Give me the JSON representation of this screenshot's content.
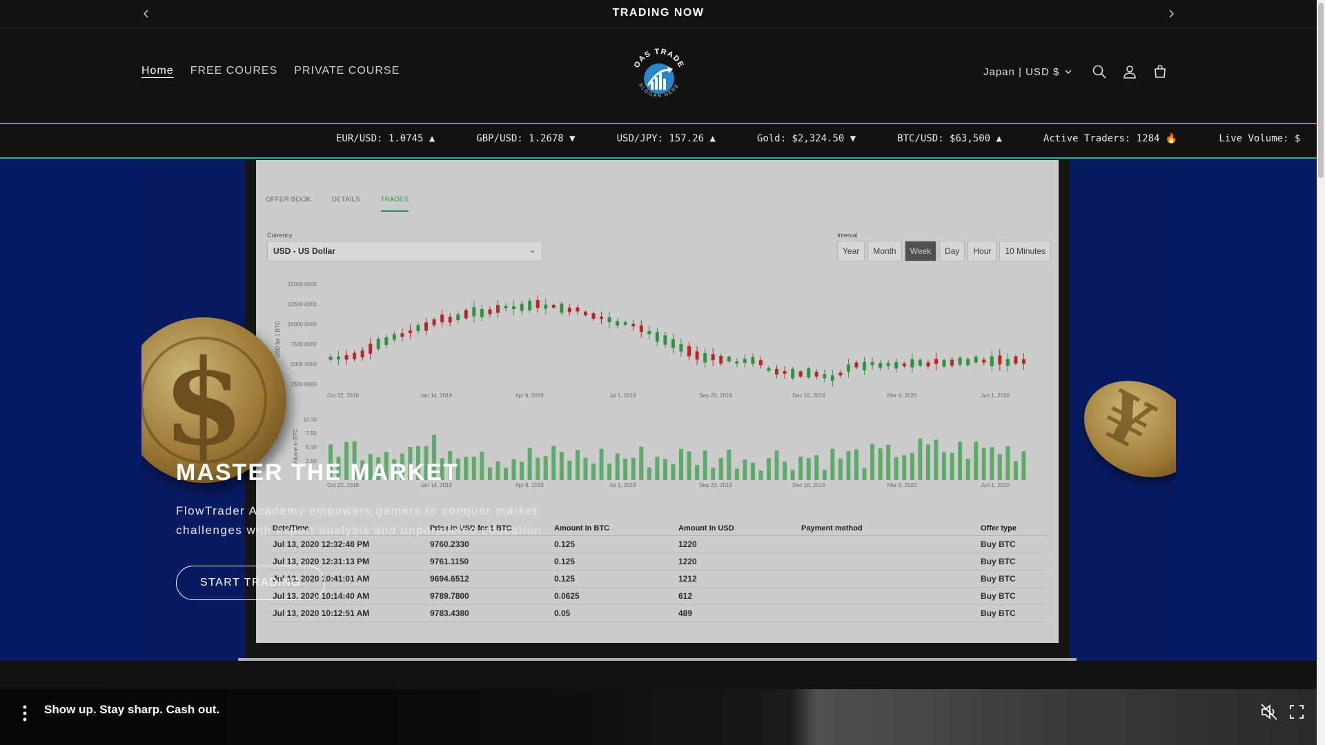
{
  "announcement": {
    "text": "TRADING NOW",
    "prev_icon": "chevron-left-icon",
    "next_icon": "chevron-right-icon"
  },
  "header": {
    "nav": [
      {
        "label": "Home",
        "active": true
      },
      {
        "label": "FREE COURES",
        "active": false
      },
      {
        "label": "PRIVATE COURSE",
        "active": false
      }
    ],
    "logo_text_top": "OAS TRADE",
    "logo_text_bottom": "SLOGAN HERE",
    "locale": "Japan | USD $",
    "icons": [
      "search-icon",
      "account-icon",
      "cart-icon"
    ]
  },
  "ticker": [
    "EUR/USD: 1.0745 ▲",
    "GBP/USD: 1.2678 ▼",
    "USD/JPY: 157.26 ▲",
    "Gold: $2,324.50 ▼",
    "BTC/USD: $63,500 ▲",
    "Active Traders: 1284 🔥",
    "Live Volume: $"
  ],
  "hero": {
    "title": "MASTER THE MARKET",
    "text": "FlowTrader Academy empowers gamers to conquer market challenges with expert analysis and unparalleled education.",
    "button": "START TRADING",
    "accent": "#061a66",
    "screen": {
      "tabs": [
        {
          "label": "OFFER BOOK",
          "on": false
        },
        {
          "label": "DETAILS",
          "on": false
        },
        {
          "label": "TRADES",
          "on": true
        }
      ],
      "currency_label": "Currency",
      "currency_value": "USD - US Dollar",
      "interval_label": "Interval",
      "intervals": [
        {
          "label": "Year",
          "on": false
        },
        {
          "label": "Month",
          "on": false
        },
        {
          "label": "Week",
          "on": true
        },
        {
          "label": "Day",
          "on": false
        },
        {
          "label": "Hour",
          "on": false
        },
        {
          "label": "10 Minutes",
          "on": false
        }
      ],
      "price_ylabel": "USD for 1 BTC",
      "price_yticks": [
        "15000.0000",
        "12500.0000",
        "10000.0000",
        "7500.0000",
        "5000.0000",
        "2500.0000"
      ],
      "vol_ylabel": "Volume in BTC",
      "vol_yticks": [
        "10.00",
        "7.50",
        "5.00",
        "2.50"
      ],
      "xticks": [
        "Oct 22, 2018",
        "Jan 14, 2019",
        "Apr 8, 2019",
        "Jul 1, 2019",
        "Sep 23, 2019",
        "Dec 16, 2019",
        "Mar 9, 2020",
        "Jun 1, 2020"
      ],
      "table": {
        "headers": [
          "Date/Time",
          "Price in USD for 1 BTC",
          "Amount in BTC",
          "Amount in USD",
          "Payment method",
          "Offer type"
        ],
        "rows": [
          [
            "Jul 13, 2020 12:32:48 PM",
            "9760.2330",
            "0.125",
            "1220",
            "",
            "Buy BTC"
          ],
          [
            "Jul 13, 2020 12:31:13 PM",
            "9761.1150",
            "0.125",
            "1220",
            "",
            "Buy BTC"
          ],
          [
            "Jul 13, 2020 10:41:01 AM",
            "9694.6512",
            "0.125",
            "1212",
            "",
            "Buy BTC"
          ],
          [
            "Jul 13, 2020 10:14:40 AM",
            "9789.7800",
            "0.0625",
            "612",
            "",
            "Buy BTC"
          ],
          [
            "Jul 13, 2020 10:12:51 AM",
            "9783.4380",
            "0.05",
            "489",
            "",
            "Buy BTC"
          ]
        ]
      }
    }
  },
  "video_bar": {
    "caption": "Show up. Stay sharp. Cash out.",
    "icons": [
      "menu-dots-icon",
      "mute-icon",
      "fullscreen-icon"
    ]
  },
  "colors": {
    "ticker_border": "#2fb5a6",
    "up": "#3aa64a",
    "down": "#d12b2b"
  }
}
